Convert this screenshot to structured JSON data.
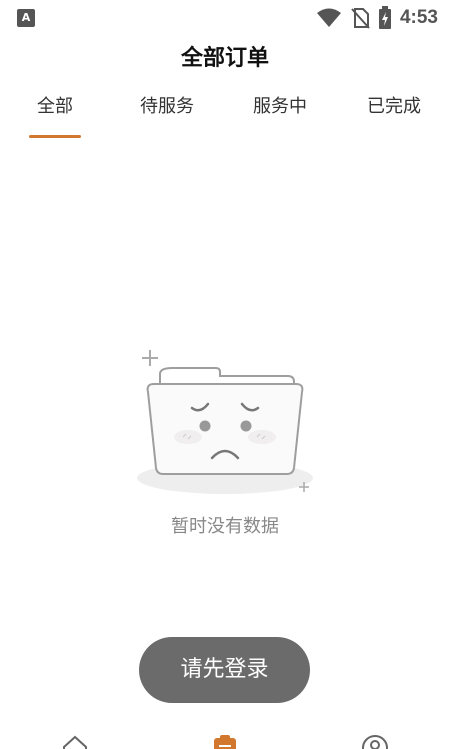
{
  "status_bar": {
    "time": "4:53",
    "left_badge": "A",
    "icons": [
      "wifi-icon",
      "no-sim-icon",
      "battery-charging-icon"
    ]
  },
  "header": {
    "title": "全部订单"
  },
  "tabs": [
    {
      "label": "全部",
      "active": true
    },
    {
      "label": "待服务",
      "active": false
    },
    {
      "label": "服务中",
      "active": false
    },
    {
      "label": "已完成",
      "active": false
    }
  ],
  "empty_state": {
    "icon": "sad-folder-icon",
    "message": "暂时没有数据"
  },
  "login_button": {
    "label": "请先登录"
  },
  "bottom_nav": {
    "items": [
      {
        "icon": "home-icon",
        "active": false
      },
      {
        "icon": "orders-icon",
        "active": true
      },
      {
        "icon": "profile-icon",
        "active": false
      }
    ]
  },
  "colors": {
    "accent": "#d2782e",
    "button_bg": "#6b6b6b",
    "muted_text": "#888888"
  }
}
